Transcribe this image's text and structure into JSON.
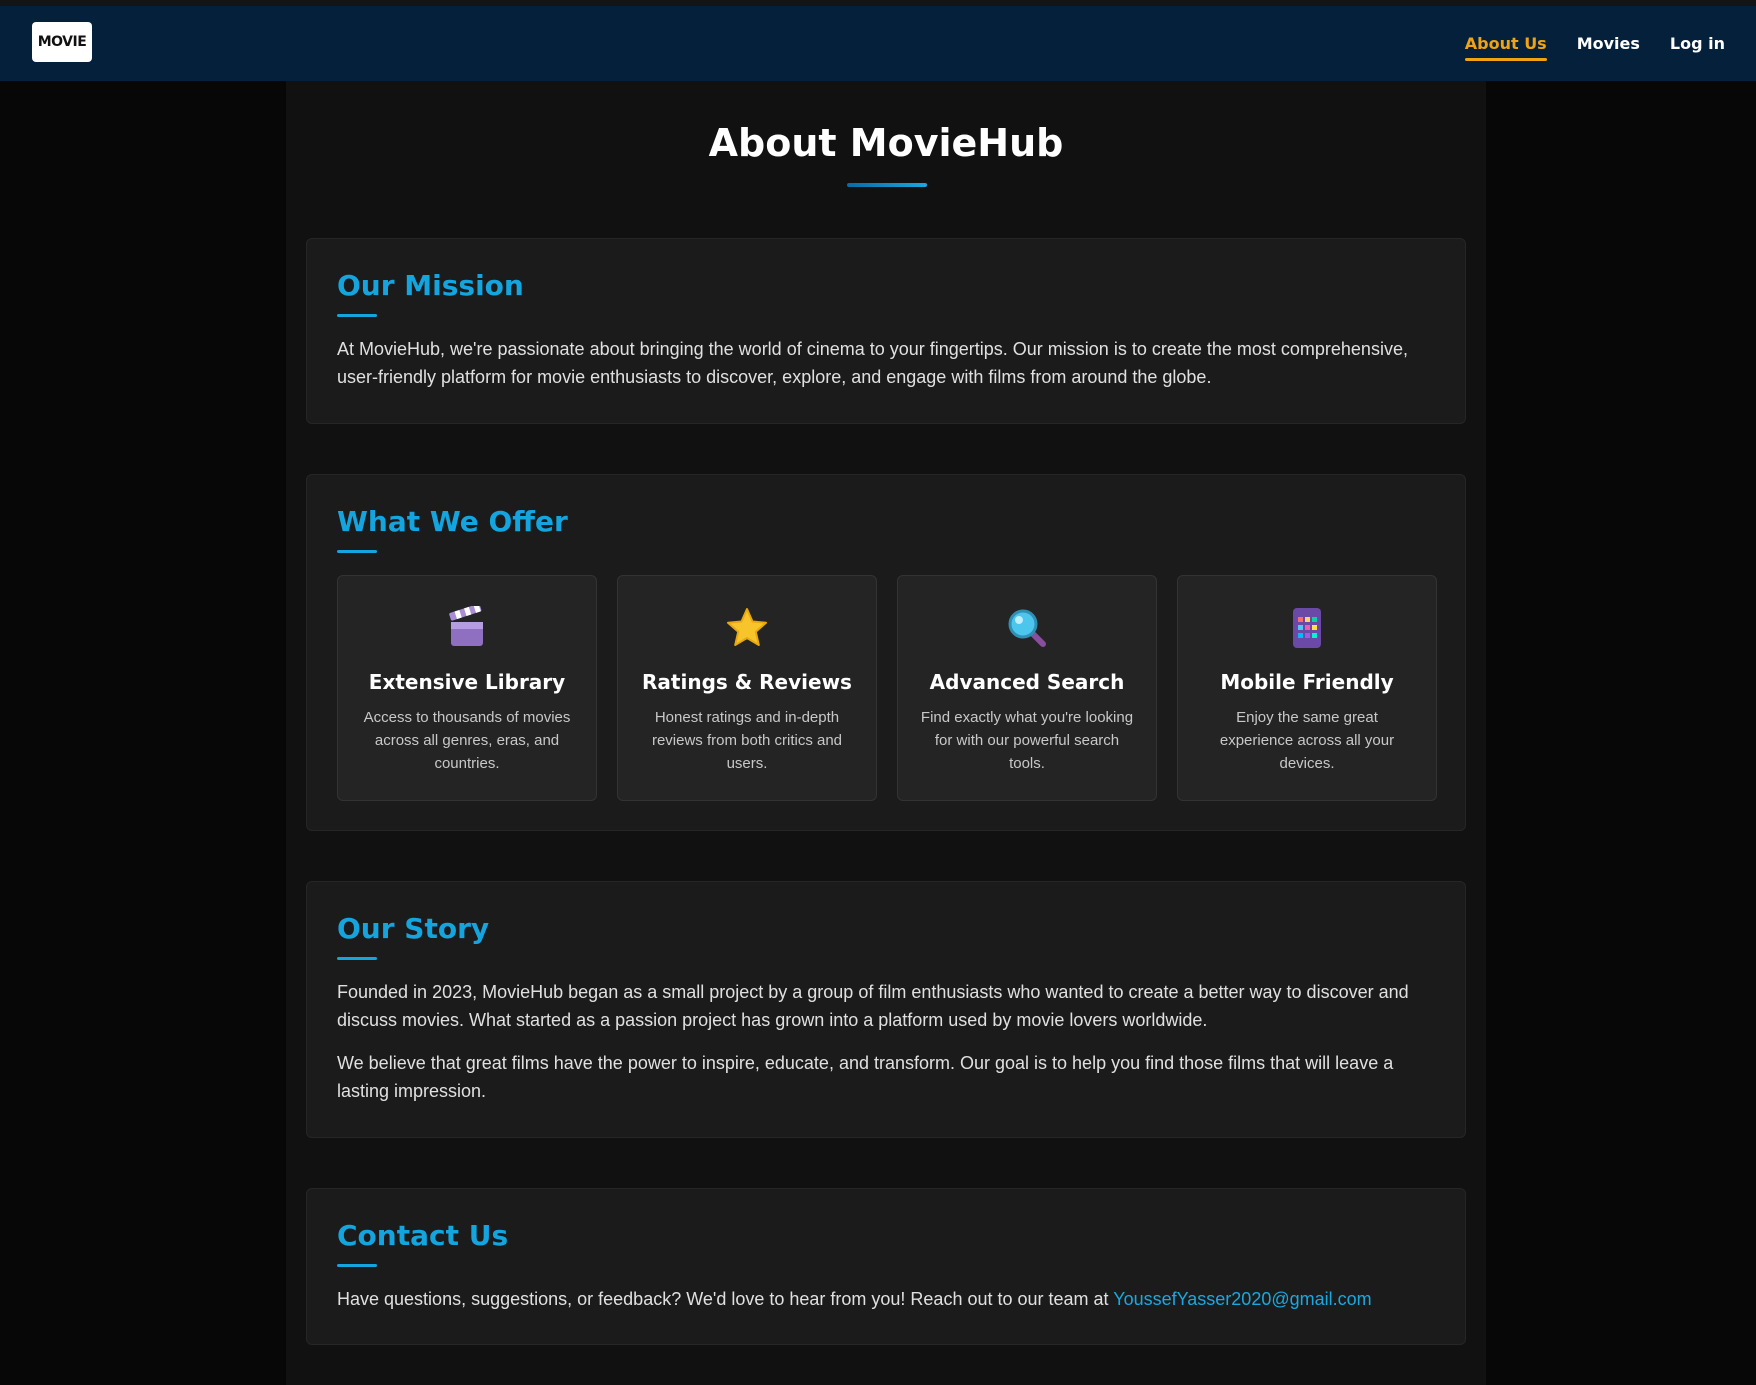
{
  "navbar": {
    "logo_text": "MOVIE",
    "links": [
      {
        "label": "About Us",
        "active": true
      },
      {
        "label": "Movies",
        "active": false
      },
      {
        "label": "Log in",
        "active": false
      }
    ]
  },
  "page": {
    "title": "About MovieHub"
  },
  "mission": {
    "heading": "Our Mission",
    "text": "At MovieHub, we're passionate about bringing the world of cinema to your fingertips. Our mission is to create the most comprehensive, user-friendly platform for movie enthusiasts to discover, explore, and engage with films from around the globe."
  },
  "offer": {
    "heading": "What We Offer",
    "items": [
      {
        "icon": "clapperboard-icon",
        "title": "Extensive Library",
        "desc": "Access to thousands of movies across all genres, eras, and countries."
      },
      {
        "icon": "star-icon",
        "title": "Ratings & Reviews",
        "desc": "Honest ratings and in-depth reviews from both critics and users."
      },
      {
        "icon": "magnifier-icon",
        "title": "Advanced Search",
        "desc": "Find exactly what you're looking for with our powerful search tools."
      },
      {
        "icon": "mobile-phone-icon",
        "title": "Mobile Friendly",
        "desc": "Enjoy the same great experience across all your devices."
      }
    ]
  },
  "story": {
    "heading": "Our Story",
    "paragraphs": [
      "Founded in 2023, MovieHub began as a small project by a group of film enthusiasts who wanted to create a better way to discover and discuss movies. What started as a passion project has grown into a platform used by movie lovers worldwide.",
      "We believe that great films have the power to inspire, educate, and transform. Our goal is to help you find those films that will leave a lasting impression."
    ]
  },
  "contact": {
    "heading": "Contact Us",
    "text": "Have questions, suggestions, or feedback? We'd love to hear from you! Reach out to our team at ",
    "email": "YoussefYasser2020@gmail.com"
  },
  "colors": {
    "navbar_bg": "#04203a",
    "accent_blue": "#14a4de",
    "active_orange": "#f0a313",
    "card_bg": "#1b1b1b",
    "page_bg": "#111111"
  }
}
